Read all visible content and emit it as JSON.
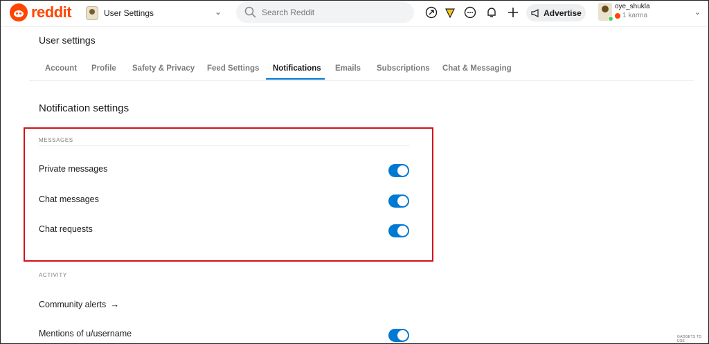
{
  "header": {
    "logo_text": "reddit",
    "community_title": "User Settings",
    "search_placeholder": "Search Reddit",
    "advertise_label": "Advertise",
    "username": "oye_shukla",
    "karma": "1 karma"
  },
  "page": {
    "title": "User settings",
    "tabs": [
      {
        "label": "Account"
      },
      {
        "label": "Profile"
      },
      {
        "label": "Safety & Privacy"
      },
      {
        "label": "Feed Settings"
      },
      {
        "label": "Notifications"
      },
      {
        "label": "Emails"
      },
      {
        "label": "Subscriptions"
      },
      {
        "label": "Chat & Messaging"
      }
    ],
    "active_tab": "Notifications"
  },
  "notifications": {
    "section_title": "Notification settings",
    "messages_group": "MESSAGES",
    "private_messages": "Private messages",
    "chat_messages": "Chat messages",
    "chat_requests": "Chat requests",
    "activity_group": "ACTIVITY",
    "community_alerts": "Community alerts",
    "community_alerts_arrow": "→",
    "mentions": "Mentions of u/username",
    "toggles": {
      "private_messages": true,
      "chat_messages": true,
      "chat_requests": true,
      "mentions": true
    }
  },
  "colors": {
    "brand": "#ff4500",
    "accent": "#0079d3",
    "highlight": "#d0121b"
  },
  "watermark": "GADGETS TO USE"
}
